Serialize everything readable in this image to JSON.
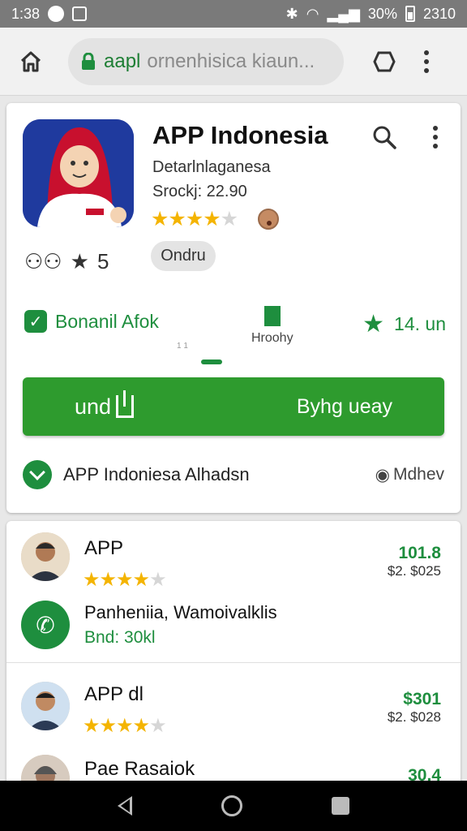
{
  "statusbar": {
    "time": "1:38",
    "battery_pct": "30%",
    "clock_right": "2310"
  },
  "browser": {
    "url_host": "aapl",
    "url_rest": "ornenhisica kiaun..."
  },
  "app": {
    "title": "APP Indonesia",
    "developer": "Detarlnlaganesa",
    "meta": "Srockj: 22.90",
    "rating_stars": 3.5,
    "rating_row_text": "5",
    "chip_label": "Ondru",
    "feature_left": "Bonanil Afok",
    "feature_mid_label": "Hroohy",
    "feature_right": "14. un",
    "tiny_ticks": "1 1",
    "install_label": "und",
    "install_right": "Byhg ueay",
    "footer_text": "APP Indoniesa Alhadsn",
    "footer_right": "Mdhev"
  },
  "list": [
    {
      "title": "APP",
      "stars": 4,
      "price": "101.8",
      "sub": "$2. $025"
    },
    {
      "desc": "Panheniia, Wamoivalklis",
      "green": "Bnd: 30kl"
    },
    {
      "title": "APP dl",
      "stars": 4,
      "price": "$301",
      "sub": "$2. $028"
    },
    {
      "title": "Pae Rasaiok",
      "price": "30.4"
    }
  ],
  "colors": {
    "accent": "#1e8e3e",
    "install_button": "#2e9b2e",
    "star": "#f4b400",
    "icon_bg": "#1f3a9e",
    "hijab": "#c8102e"
  }
}
